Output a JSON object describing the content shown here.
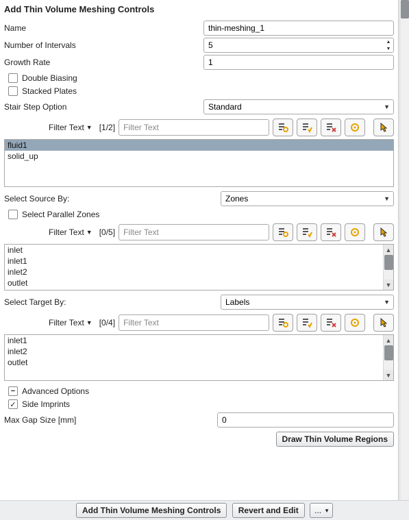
{
  "title": "Add Thin Volume Meshing Controls",
  "fields": {
    "name_label": "Name",
    "name_value": "thin-meshing_1",
    "intervals_label": "Number of Intervals",
    "intervals_value": "5",
    "growth_label": "Growth Rate",
    "growth_value": "1",
    "double_biasing_label": "Double Biasing",
    "stacked_plates_label": "Stacked Plates",
    "stair_step_label": "Stair Step Option",
    "stair_step_value": "Standard"
  },
  "filter": {
    "drop_label": "Filter Text",
    "placeholder": "Filter Text"
  },
  "bodies": {
    "counter": "[1/2]",
    "items": [
      "fluid1",
      "solid_up"
    ],
    "selected_index": 0
  },
  "source": {
    "label": "Select Source By:",
    "value": "Zones",
    "parallel_label": "Select Parallel Zones",
    "counter": "[0/5]",
    "items": [
      "inlet",
      "inlet1",
      "inlet2",
      "outlet"
    ]
  },
  "target": {
    "label": "Select Target By:",
    "value": "Labels",
    "counter": "[0/4]",
    "items": [
      "inlet1",
      "inlet2",
      "outlet"
    ]
  },
  "advanced": {
    "label": "Advanced Options",
    "side_imprints_label": "Side Imprints",
    "max_gap_label": "Max Gap Size [mm]",
    "max_gap_value": "0"
  },
  "buttons": {
    "draw": "Draw Thin Volume Regions",
    "add": "Add Thin Volume Meshing Controls",
    "revert": "Revert and Edit",
    "more": "..."
  }
}
